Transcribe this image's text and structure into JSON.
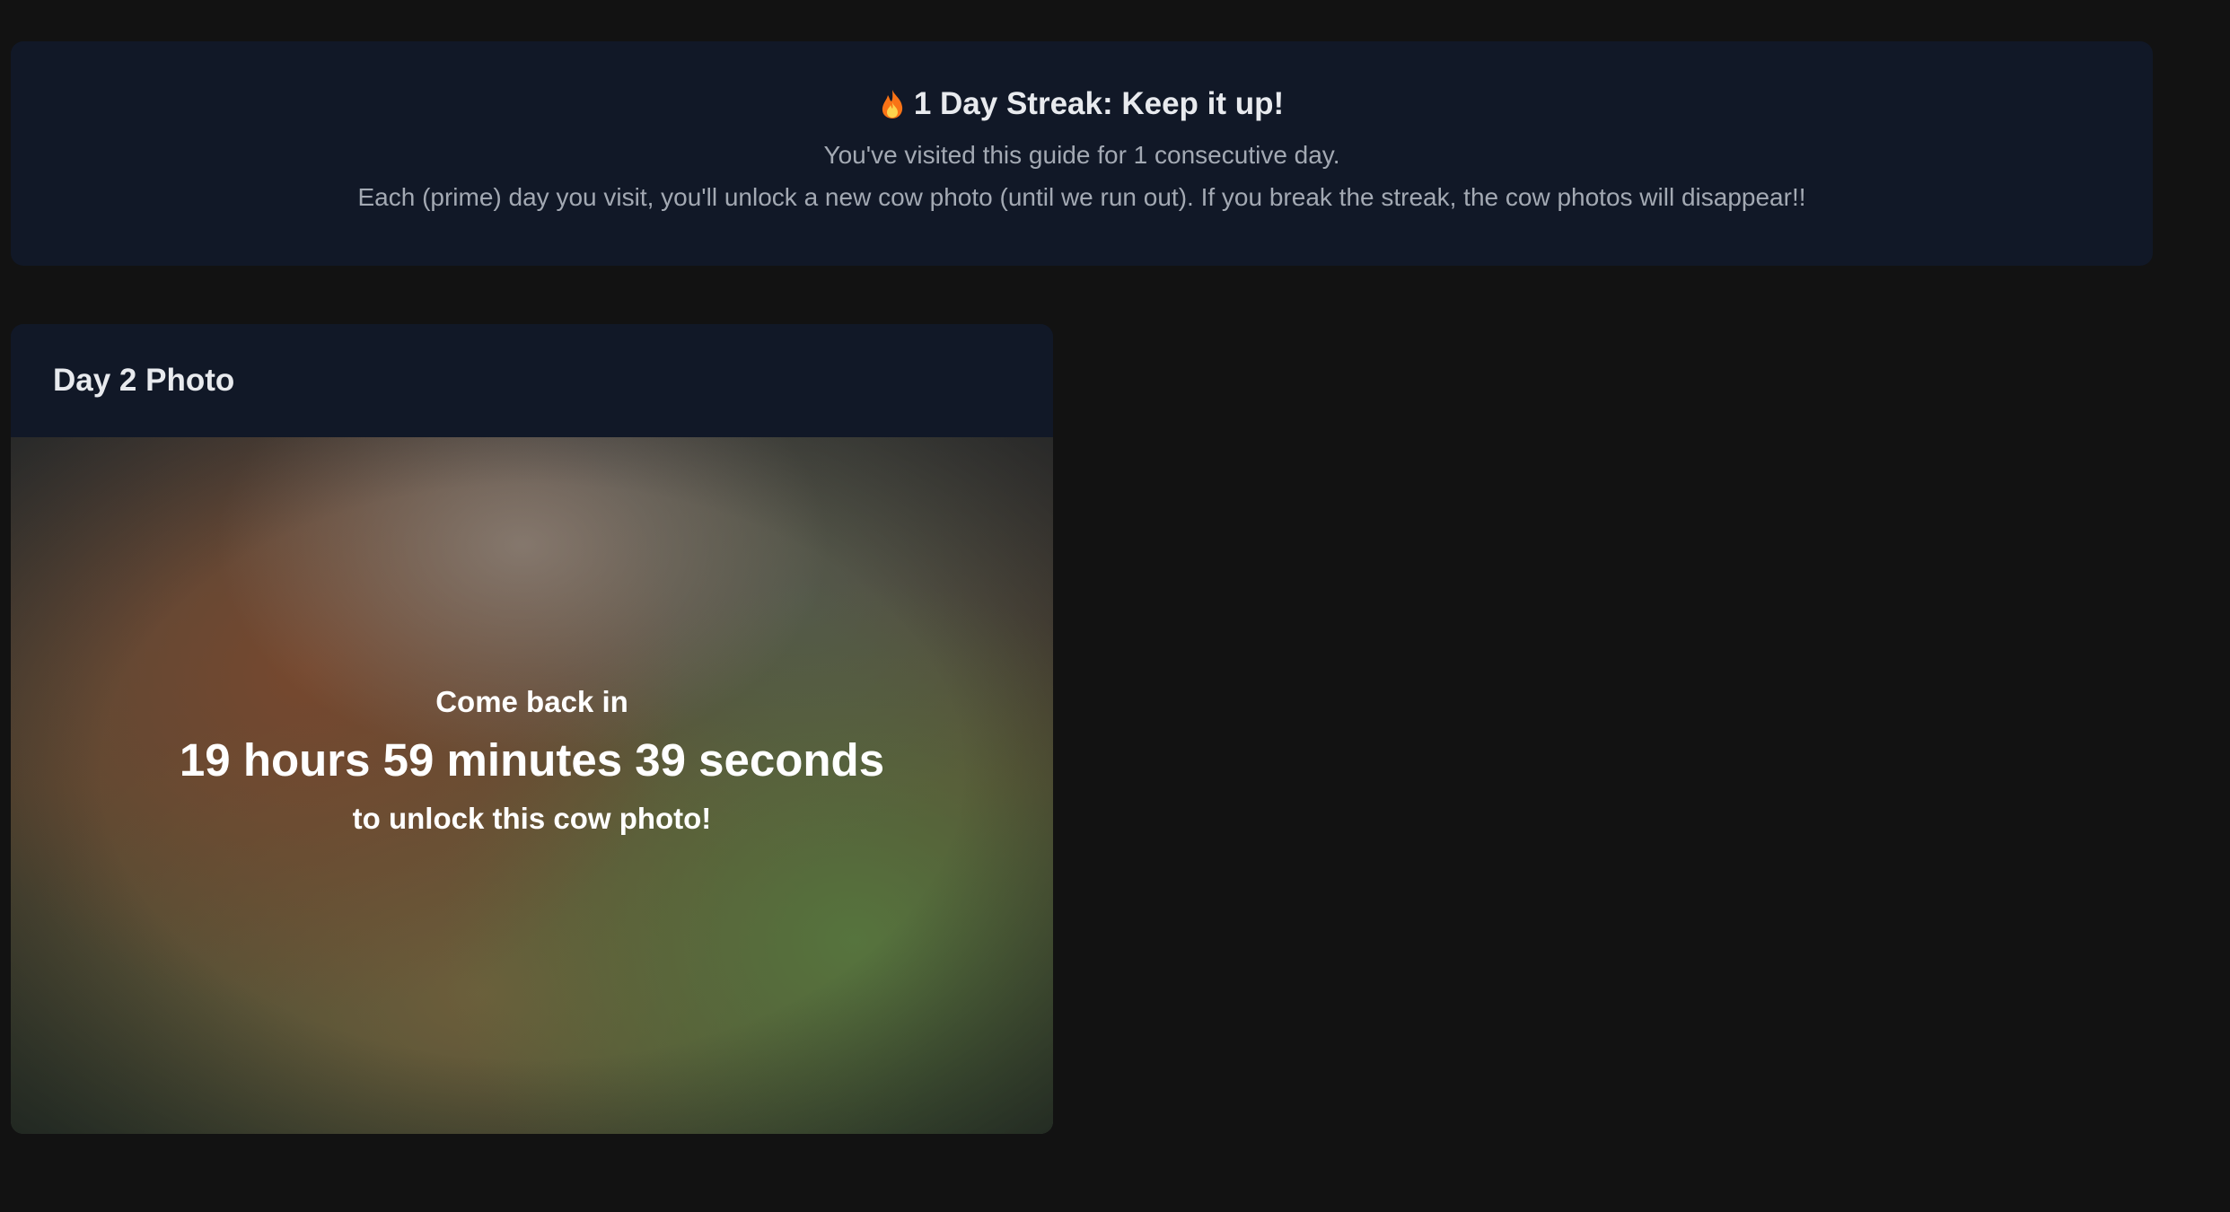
{
  "streak": {
    "icon": "flame-icon",
    "title": "1 Day Streak: Keep it up!",
    "subtitle": "You've visited this guide for 1 consecutive day.",
    "description": "Each (prime) day you visit, you'll unlock a new cow photo (until we run out). If you break the streak, the cow photos will disappear!!"
  },
  "photo_card": {
    "title": "Day 2 Photo",
    "come_back_text": "Come back in",
    "countdown": "19 hours 59 minutes 39 seconds",
    "unlock_text": "to unlock this cow photo!"
  },
  "colors": {
    "page_background": "#121212",
    "card_background": "#111827",
    "flame": "#f97316"
  }
}
